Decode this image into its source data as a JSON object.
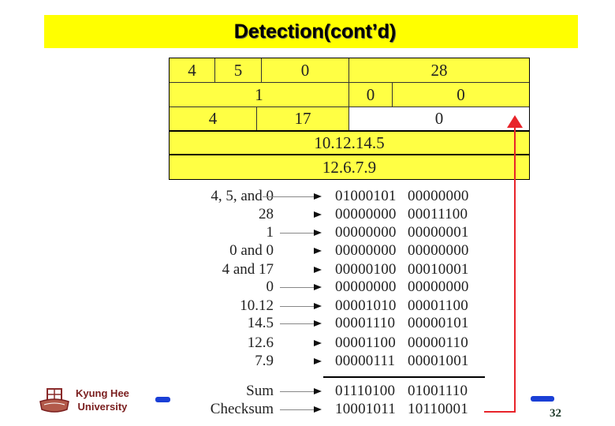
{
  "slide": {
    "title": "Detection(cont’d)",
    "page_number": "32",
    "footer": {
      "university_line1": "Kyung Hee",
      "university_line2": "University",
      "logo_icon": "university-seal-icon"
    },
    "colors": {
      "title_bar": "#ffff00",
      "table_fill": "#ffff44",
      "checksum_arrow": "#e8242a",
      "footer_text": "#7a1e1e",
      "accent_dash": "#1a3fd6"
    }
  },
  "header_table": {
    "rows": [
      [
        "4",
        "5",
        "0",
        "28"
      ],
      [
        "1",
        "0",
        "0"
      ],
      [
        "4",
        "17",
        "0"
      ],
      [
        "10.12.14.5"
      ],
      [
        "12.6.7.9"
      ]
    ]
  },
  "calculation": {
    "rows": [
      {
        "label": "4, 5,  and 0",
        "bits1": "01000101",
        "bits2": "00000000"
      },
      {
        "label": "28",
        "bits1": "00000000",
        "bits2": "00011100"
      },
      {
        "label": "1",
        "bits1": "00000000",
        "bits2": "00000001"
      },
      {
        "label": "0 and 0",
        "bits1": "00000000",
        "bits2": "00000000"
      },
      {
        "label": "4 and 17",
        "bits1": "00000100",
        "bits2": "00010001"
      },
      {
        "label": "0",
        "bits1": "00000000",
        "bits2": "00000000"
      },
      {
        "label": "10.12",
        "bits1": "00001010",
        "bits2": "00001100"
      },
      {
        "label": "14.5",
        "bits1": "00001110",
        "bits2": "00000101"
      },
      {
        "label": "12.6",
        "bits1": "00001100",
        "bits2": "00000110"
      },
      {
        "label": "7.9",
        "bits1": "00000111",
        "bits2": "00001001"
      }
    ],
    "sum": {
      "label": "Sum",
      "bits1": "01110100",
      "bits2": "01001110"
    },
    "checksum": {
      "label": "Checksum",
      "bits1": "10001011",
      "bits2": "10110001"
    }
  }
}
